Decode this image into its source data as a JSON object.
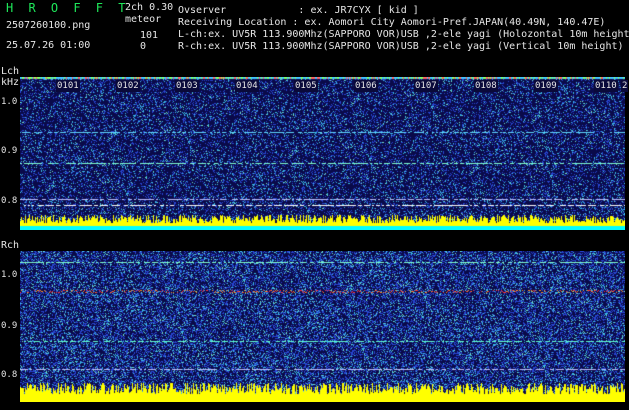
{
  "header": {
    "app_title": "H R O F F T",
    "version": "2ch 0.30",
    "filename": "2507260100.png",
    "datetime": "25.07.26 01:00",
    "meteor_label": "meteor",
    "lch_count": "101",
    "rch_count": "0",
    "observer_line": "Ovserver            : ex. JR7CYX [ kid ]",
    "location_line": "Receiving Location : ex. Aomori City Aomori-Pref.JAPAN(40.49N, 140.47E)",
    "lch_line": "L-ch:ex. UV5R 113.900Mhz(SAPPORO VOR)USB ,2-ele yagi (Holozontal 10m height",
    "rch_line": "R-ch:ex. UV5R 113.900Mhz(SAPPORO VOR)USB ,2-ele yagi (Vertical 10m height)"
  },
  "lch": {
    "label": "Lch",
    "unit": "kHz",
    "yticks": [
      "1.0",
      "0.9",
      "0.8"
    ],
    "xticks": [
      "0101",
      "0102",
      "0103",
      "0104",
      "0105",
      "0106",
      "0107",
      "0108",
      "0109",
      "0110",
      "2"
    ]
  },
  "rch": {
    "label": "Rch",
    "yticks": [
      "1.0",
      "0.9",
      "0.8"
    ]
  },
  "colors": {
    "header_title": "#1ee85a",
    "text": "#e6e6e6",
    "spectrogram_bg": "#0a0a4a",
    "noise_blue": "#3a5adc",
    "noise_cyan": "#40c8e8",
    "meteor_red": "#ff3030",
    "signal_yellow": "#ffff00",
    "baseline_cyan": "#00ffff"
  }
}
